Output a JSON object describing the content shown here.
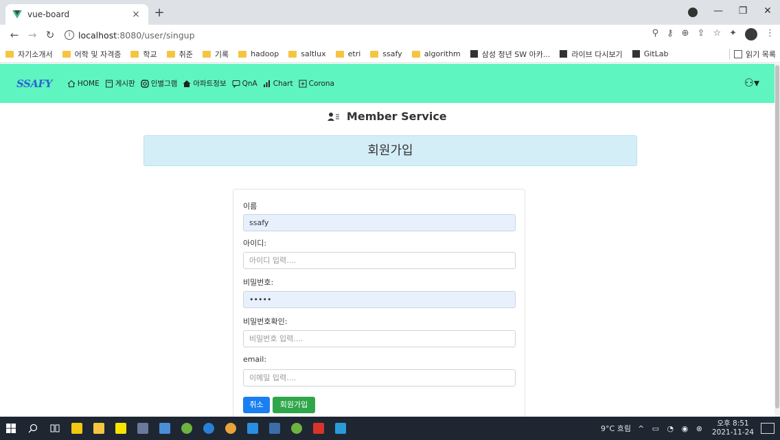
{
  "browser": {
    "tab_title": "vue-board",
    "tab_close": "×",
    "new_tab": "+",
    "url_host": "localhost",
    "url_rest": ":8080/user/singup",
    "win_min": "—",
    "win_max": "❐",
    "win_close": "✕"
  },
  "bookmarks": [
    {
      "label": "자기소개서",
      "icon": "folder"
    },
    {
      "label": "어학 및 자격증",
      "icon": "folder"
    },
    {
      "label": "학교",
      "icon": "folder"
    },
    {
      "label": "취준",
      "icon": "folder"
    },
    {
      "label": "기록",
      "icon": "folder"
    },
    {
      "label": "hadoop",
      "icon": "folder"
    },
    {
      "label": "saltlux",
      "icon": "folder"
    },
    {
      "label": "etri",
      "icon": "folder"
    },
    {
      "label": "ssafy",
      "icon": "folder"
    },
    {
      "label": "algorithm",
      "icon": "folder"
    },
    {
      "label": "삼성 청년 SW 아카...",
      "icon": "page"
    },
    {
      "label": "라이브 다시보기",
      "icon": "page"
    },
    {
      "label": "GitLab",
      "icon": "page"
    }
  ],
  "bookmarks_reading_list": "읽기 목록",
  "nav": {
    "logo": "SSAFY",
    "items": [
      "HOME",
      "게시판",
      "인별그램",
      "아파트정보",
      "QnA",
      "Chart",
      "Corona"
    ],
    "user_menu": "⚇▾"
  },
  "page": {
    "heading": "Member Service",
    "banner": "회원가입"
  },
  "form": {
    "name_label": "이름",
    "name_value": "ssafy",
    "id_label": "아이디:",
    "id_placeholder": "아이디 입력....",
    "pw_label": "비밀번호:",
    "pw_value": "•••••",
    "pw_confirm_label": "비밀번호확인:",
    "pw_confirm_placeholder": "비밀번호 입력....",
    "email_label": "email:",
    "email_placeholder": "이메일 입력....",
    "cancel": "취소",
    "submit": "회원가입"
  },
  "taskbar": {
    "weather": "9°C 흐림",
    "time": "오후 8:51",
    "date": "2021-11-24"
  },
  "colors": {
    "nav_bg": "#5ef5c0",
    "banner_bg": "#d4eef8",
    "cancel_btn": "#1a7ff0",
    "submit_btn": "#30a64a"
  }
}
